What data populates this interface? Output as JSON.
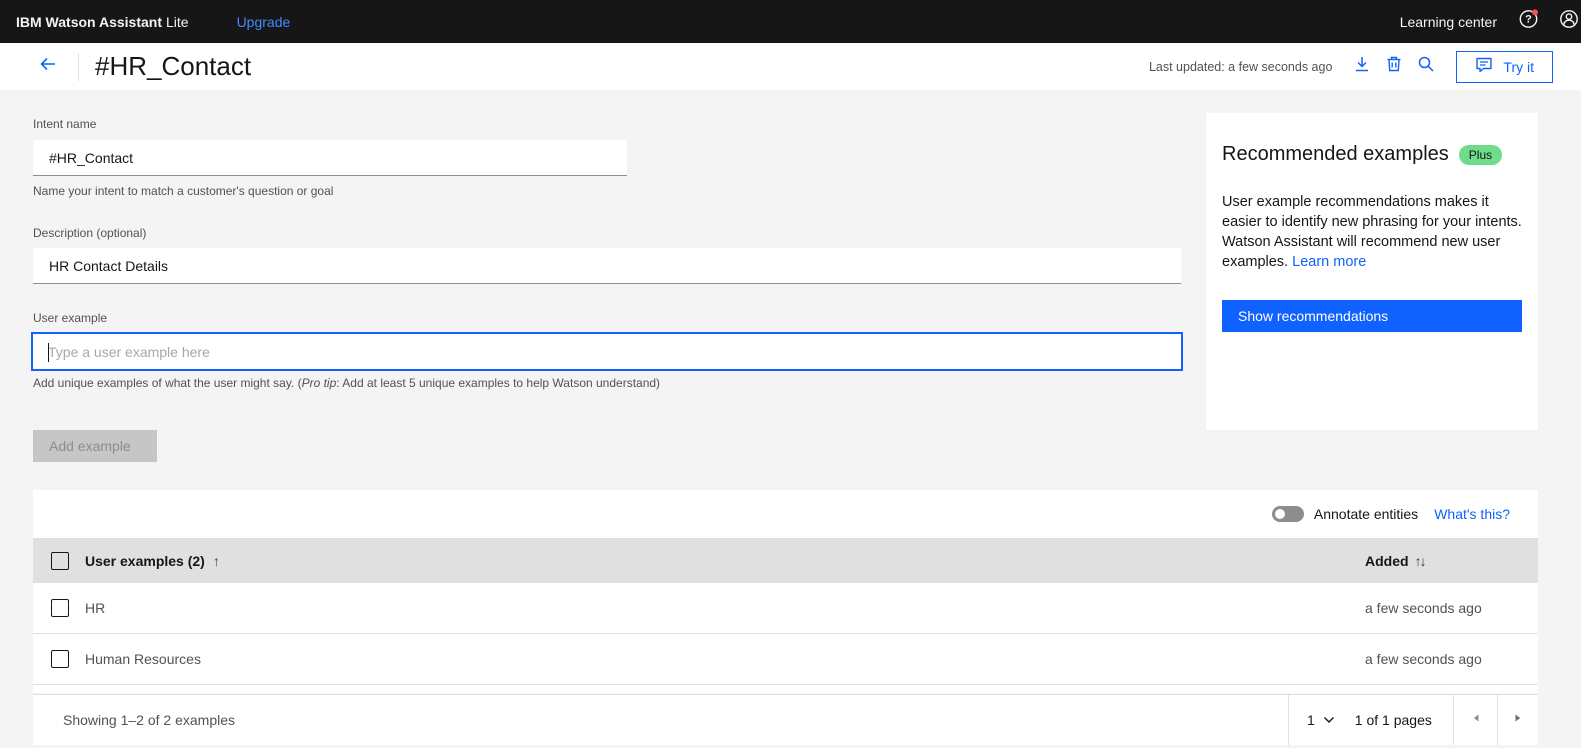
{
  "colors": {
    "accent_blue": "#0f62fe",
    "topbar_bg": "#161616",
    "upgrade_link": "#4589ff",
    "page_bg": "#f4f4f4",
    "table_header_bg": "#e0e0e0",
    "badge_green": "#6fdc8c",
    "notification_red": "#fa4d56",
    "disabled_button_bg": "#c6c6c6"
  },
  "topbar": {
    "brand_main": "IBM Watson Assistant",
    "brand_edition": "Lite",
    "upgrade_label": "Upgrade",
    "learning_center_label": "Learning center"
  },
  "header": {
    "title": "#HR_Contact",
    "last_updated": "Last updated: a few seconds ago",
    "try_it_label": "Try it"
  },
  "form": {
    "intent_name": {
      "label": "Intent name",
      "value": "#HR_Contact",
      "helper": "Name your intent to match a customer's question or goal"
    },
    "description": {
      "label": "Description (optional)",
      "value": "HR Contact Details"
    },
    "user_example": {
      "label": "User example",
      "placeholder": "Type a user example here",
      "helper_prefix": "Add unique examples of what the user might say. (",
      "helper_protip": "Pro tip",
      "helper_suffix": ": Add at least 5 unique examples to help Watson understand)"
    },
    "add_example_label": "Add example"
  },
  "recommendations": {
    "title": "Recommended examples",
    "badge": "Plus",
    "body": "User example recommendations makes it easier to identify new phrasing for your intents. Watson Assistant will recommend new user examples. ",
    "learn_more_label": "Learn more",
    "show_button_label": "Show recommendations"
  },
  "examples_table": {
    "annotate_label": "Annotate entities",
    "whats_this_label": "What's this?",
    "name_column": "User examples (2)",
    "name_sort_icon": "↑",
    "added_column": "Added",
    "added_sort_icon": "↑↓",
    "rows": [
      {
        "text": "HR",
        "added": "a few seconds ago"
      },
      {
        "text": "Human Resources",
        "added": "a few seconds ago"
      }
    ]
  },
  "pagination": {
    "showing_text": "Showing 1–2 of 2 examples",
    "page_value": "1",
    "pages_text": "1 of 1 pages"
  }
}
